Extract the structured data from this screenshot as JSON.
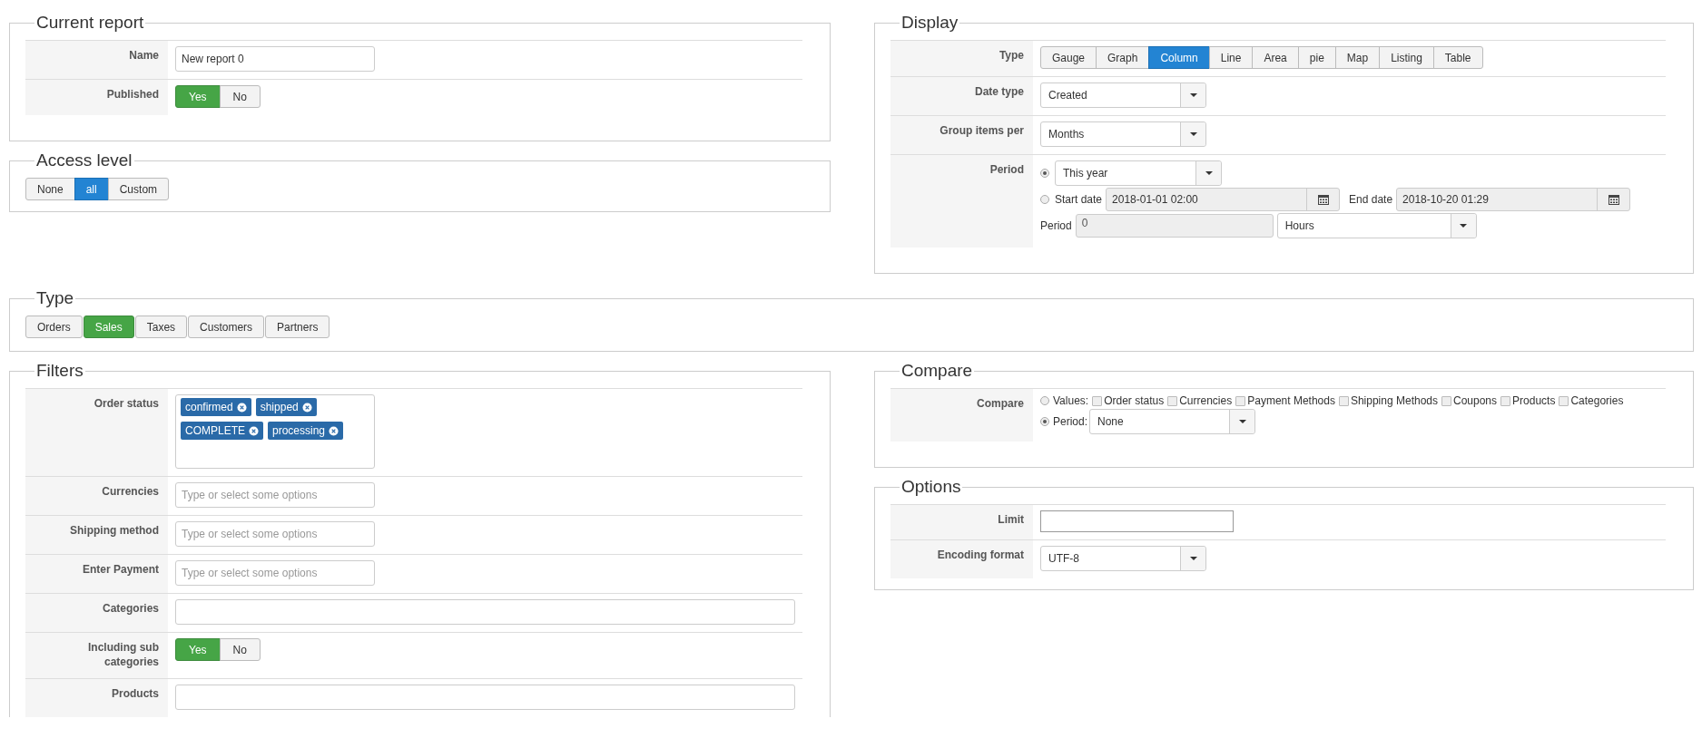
{
  "current_report": {
    "legend": "Current report",
    "name": {
      "label": "Name",
      "value": "New report 0"
    },
    "published": {
      "label": "Published",
      "options": [
        {
          "label": "Yes",
          "selected": true
        },
        {
          "label": "No",
          "selected": false
        }
      ]
    }
  },
  "access_level": {
    "legend": "Access level",
    "options": [
      {
        "label": "None",
        "selected": false
      },
      {
        "label": "all",
        "selected": true
      },
      {
        "label": "Custom",
        "selected": false
      }
    ]
  },
  "display": {
    "legend": "Display",
    "type": {
      "label": "Type",
      "options": [
        {
          "label": "Gauge",
          "selected": false
        },
        {
          "label": "Graph",
          "selected": false
        },
        {
          "label": "Column",
          "selected": true
        },
        {
          "label": "Line",
          "selected": false
        },
        {
          "label": "Area",
          "selected": false
        },
        {
          "label": "pie",
          "selected": false
        },
        {
          "label": "Map",
          "selected": false
        },
        {
          "label": "Listing",
          "selected": false
        },
        {
          "label": "Table",
          "selected": false
        }
      ]
    },
    "date_type": {
      "label": "Date type",
      "value": "Created"
    },
    "group_items_per": {
      "label": "Group items per",
      "value": "Months"
    },
    "period": {
      "label": "Period",
      "preset": {
        "selected": true,
        "value": "This year"
      },
      "range": {
        "selected": false,
        "start_label": "Start date",
        "start_value": "2018-01-01 02:00",
        "end_label": "End date",
        "end_value": "2018-10-20 01:29"
      },
      "length": {
        "label": "Period",
        "value": "0",
        "unit": "Hours"
      }
    }
  },
  "type": {
    "legend": "Type",
    "options": [
      {
        "label": "Orders",
        "selected": false
      },
      {
        "label": "Sales",
        "selected": true
      },
      {
        "label": "Taxes",
        "selected": false
      },
      {
        "label": "Customers",
        "selected": false
      },
      {
        "label": "Partners",
        "selected": false
      }
    ]
  },
  "filters": {
    "legend": "Filters",
    "rows": [
      {
        "kind": "tags",
        "label": "Order status",
        "tags": [
          "confirmed",
          "shipped",
          "COMPLETE",
          "processing"
        ]
      },
      {
        "kind": "select",
        "label": "Currencies",
        "placeholder": "Type or select some options"
      },
      {
        "kind": "select",
        "label": "Shipping method",
        "placeholder": "Type or select some options"
      },
      {
        "kind": "select",
        "label": "Enter Payment",
        "placeholder": "Type or select some options"
      },
      {
        "kind": "text",
        "label": "Categories"
      },
      {
        "kind": "toggle",
        "label": "Including sub categories",
        "options": [
          {
            "label": "Yes",
            "selected": true
          },
          {
            "label": "No",
            "selected": false
          }
        ]
      },
      {
        "kind": "text",
        "label": "Products"
      }
    ]
  },
  "compare": {
    "legend": "Compare",
    "label": "Compare",
    "values_mode": {
      "label": "Values:",
      "selected": false,
      "checkboxes": [
        {
          "label": "Order status",
          "checked": false
        },
        {
          "label": "Currencies",
          "checked": false
        },
        {
          "label": "Payment Methods",
          "checked": false
        },
        {
          "label": "Shipping Methods",
          "checked": false
        },
        {
          "label": "Coupons",
          "checked": false
        },
        {
          "label": "Products",
          "checked": false
        },
        {
          "label": "Categories",
          "checked": false
        }
      ]
    },
    "period_mode": {
      "label": "Period:",
      "selected": true,
      "value": "None"
    }
  },
  "options": {
    "legend": "Options",
    "limit": {
      "label": "Limit"
    },
    "encoding": {
      "label": "Encoding format",
      "value": "UTF-8"
    }
  }
}
